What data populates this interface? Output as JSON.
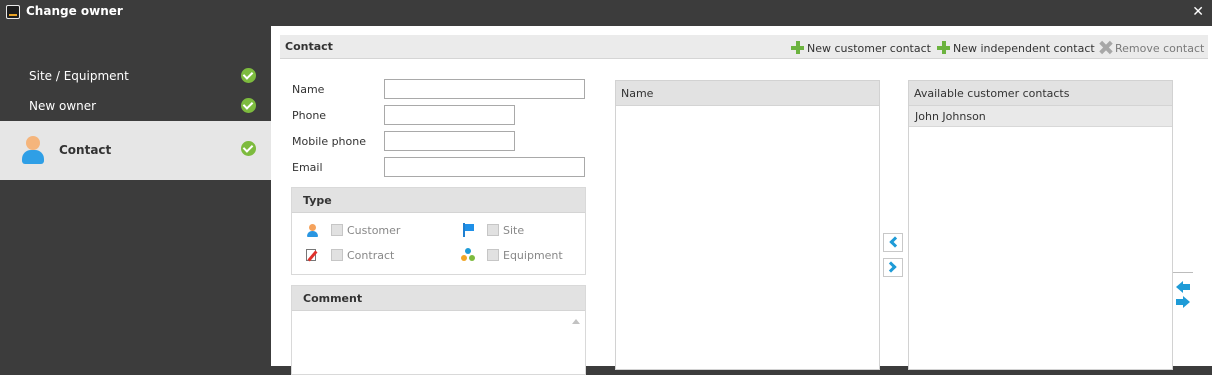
{
  "window": {
    "title": "Change owner",
    "close_glyph": "✕"
  },
  "wizard": {
    "steps": [
      {
        "label": "Site / Equipment",
        "status": "complete"
      },
      {
        "label": "New owner",
        "status": "complete"
      },
      {
        "label": "Contact",
        "status": "complete",
        "active": true,
        "icon": "person-icon"
      }
    ]
  },
  "contact": {
    "section_title": "Contact",
    "toolbar": {
      "new_customer_contact": "New customer contact",
      "new_independent_contact": "New independent contact",
      "remove_contact": "Remove contact"
    },
    "form": {
      "name_label": "Name",
      "name_value": "",
      "phone_label": "Phone",
      "phone_value": "",
      "mobile_label": "Mobile phone",
      "mobile_value": "",
      "email_label": "Email",
      "email_value": ""
    },
    "type": {
      "title": "Type",
      "options": [
        {
          "label": "Customer",
          "icon": "person-icon",
          "checked": false
        },
        {
          "label": "Site",
          "icon": "flag-icon",
          "checked": false
        },
        {
          "label": "Contract",
          "icon": "contract-icon",
          "checked": false
        },
        {
          "label": "Equipment",
          "icon": "equipment-icon",
          "checked": false
        }
      ]
    },
    "comment": {
      "title": "Comment",
      "value": ""
    }
  },
  "selected_list": {
    "header": "Name",
    "rows": []
  },
  "available_list": {
    "header": "Available customer contacts",
    "rows": [
      "John Johnson"
    ]
  },
  "colors": {
    "accent": "#1e9bd7",
    "success": "#7dbb3e",
    "add": "#6cb33f",
    "sidebar": "#3c3c3c"
  }
}
